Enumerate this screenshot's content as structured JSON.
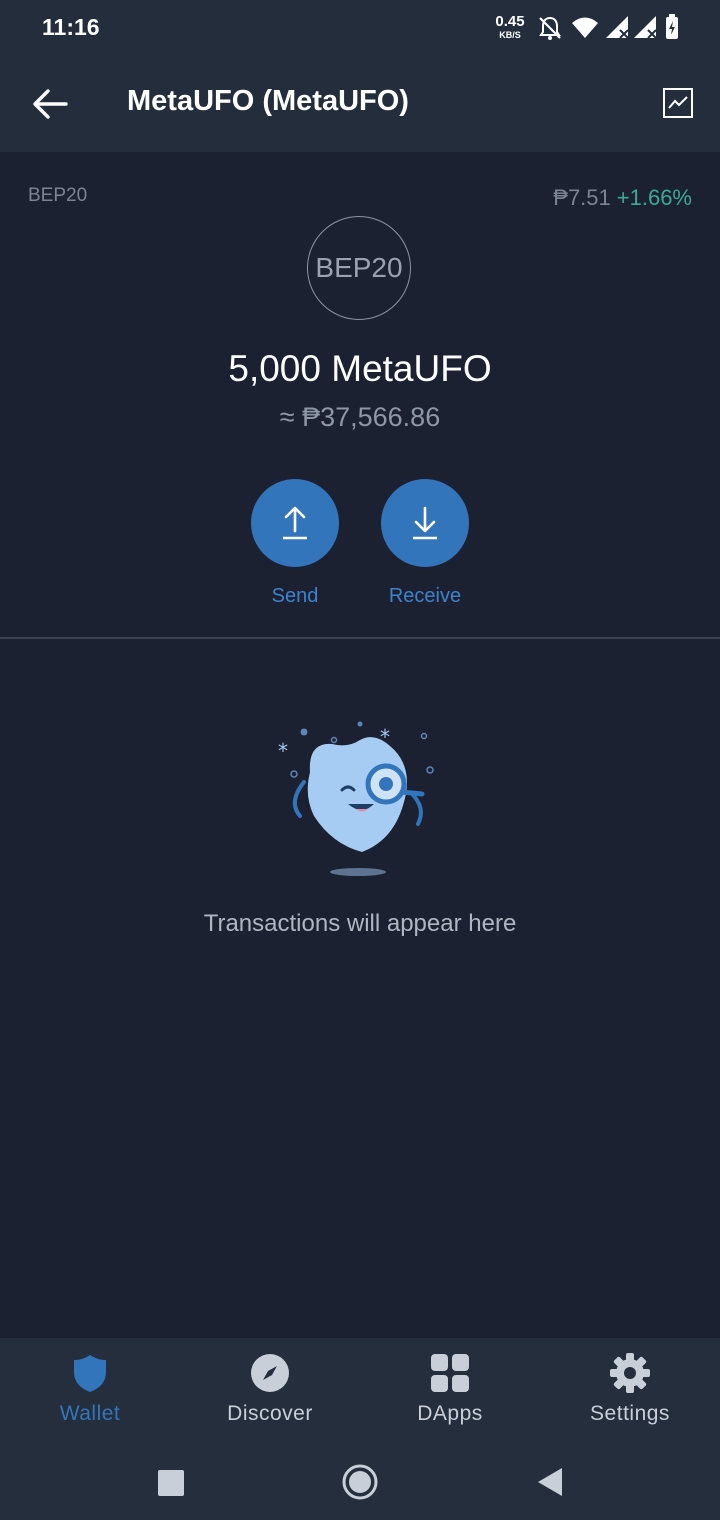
{
  "status_bar": {
    "time": "11:16",
    "speed_value": "0.45",
    "speed_unit": "KB/S",
    "icons": [
      "notifications-off-icon",
      "wifi-icon",
      "signal-icon",
      "signal-icon",
      "battery-charging-icon"
    ]
  },
  "header": {
    "title": "MetaUFO (MetaUFO)",
    "back_icon": "arrow-left-icon",
    "chart_icon": "line-chart-icon"
  },
  "token": {
    "network": "BEP20",
    "price": "₱7.51",
    "change": "+1.66%",
    "logo_text": "BEP20",
    "balance": "5,000 MetaUFO",
    "fiat_balance": "≈ ₱37,566.86"
  },
  "actions": {
    "send_label": "Send",
    "receive_label": "Receive"
  },
  "empty_state": {
    "message": "Transactions will appear here"
  },
  "bottom_nav": {
    "items": [
      {
        "label": "Wallet",
        "icon": "shield-icon",
        "active": true
      },
      {
        "label": "Discover",
        "icon": "compass-icon",
        "active": false
      },
      {
        "label": "DApps",
        "icon": "grid-icon",
        "active": false
      },
      {
        "label": "Settings",
        "icon": "gear-icon",
        "active": false
      }
    ]
  },
  "colors": {
    "background": "#1b2130",
    "header_bg": "#242d3c",
    "accent": "#3375bb",
    "positive": "#3fa796"
  }
}
